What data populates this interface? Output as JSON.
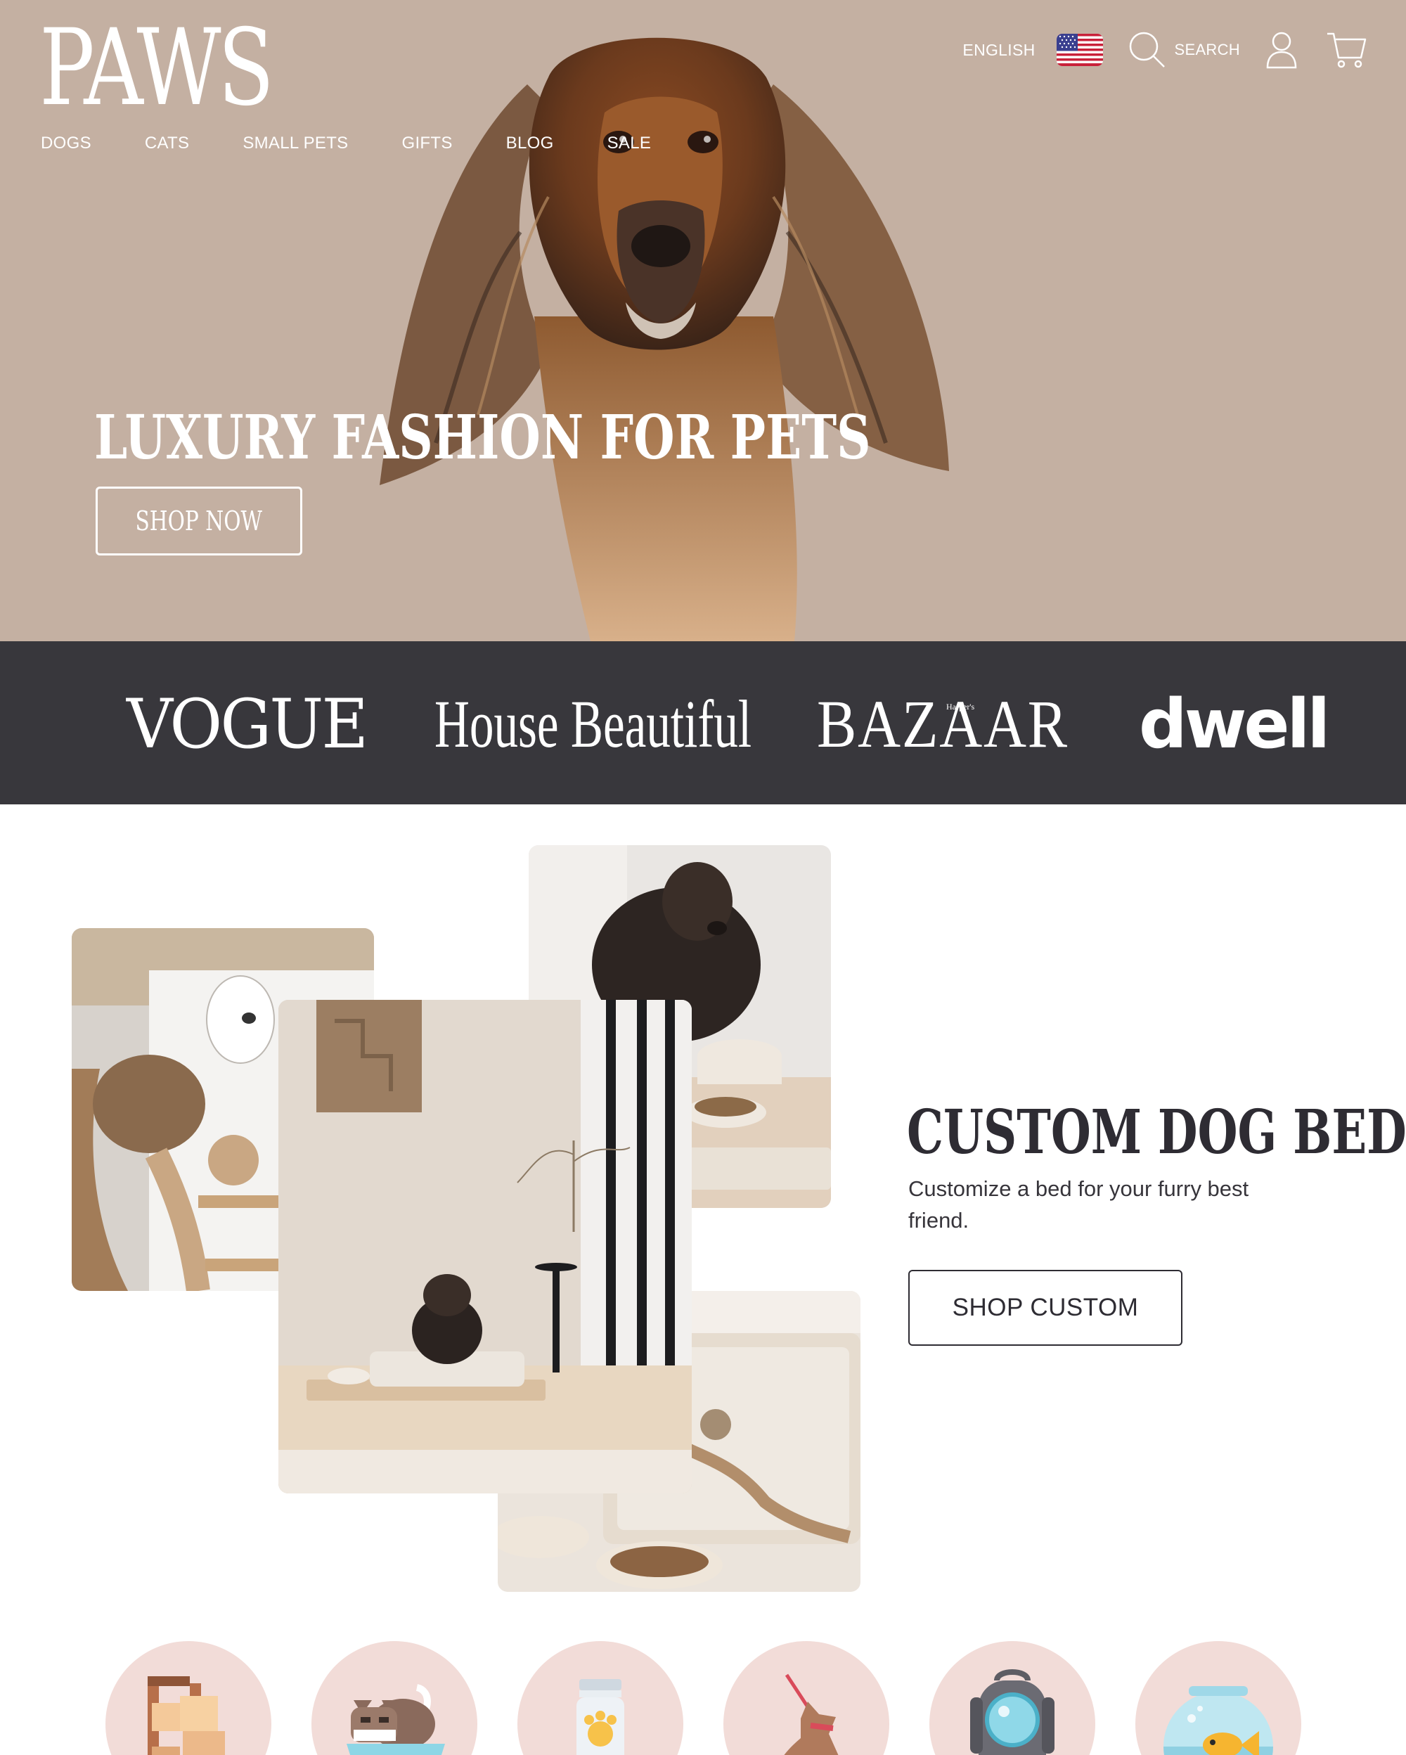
{
  "header": {
    "logo": "PAWS",
    "nav": [
      "DOGS",
      "CATS",
      "SMALL PETS",
      "GIFTS",
      "BLOG",
      "SALE"
    ],
    "language": "ENGLISH",
    "search_label": "SEARCH"
  },
  "hero": {
    "title": "LUXURY FASHION FOR PETS",
    "cta": "SHOP NOW"
  },
  "press": {
    "logos": [
      "VOGUE",
      "House Beautiful",
      "BAZAAR",
      "dwell"
    ],
    "bazaar_small": "Harper's"
  },
  "custom": {
    "title": "CUSTOM DOG BEDS",
    "description": "Customize a bed for your furry best friend.",
    "cta": "SHOP CUSTOM"
  },
  "categories": [
    {
      "icon": "cat-tree-icon"
    },
    {
      "icon": "cat-litter-icon"
    },
    {
      "icon": "treat-jar-icon"
    },
    {
      "icon": "dog-leash-icon"
    },
    {
      "icon": "pet-backpack-icon"
    },
    {
      "icon": "fish-bowl-icon"
    }
  ],
  "colors": {
    "hero_bg": "#c4b0a2",
    "press_bg": "#38373c",
    "circle_bg": "#f2dcd8",
    "text_dark": "#2e2c33"
  }
}
